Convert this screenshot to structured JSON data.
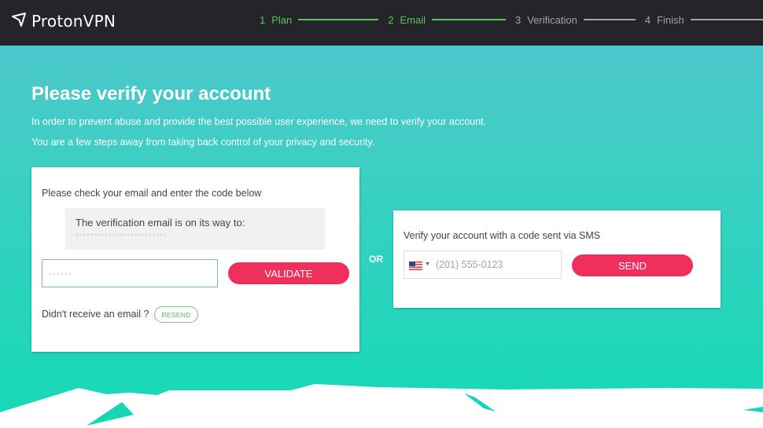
{
  "brand": {
    "name": "ProtonVPN"
  },
  "steps": [
    {
      "num": "1",
      "label": "Plan",
      "state": "done"
    },
    {
      "num": "2",
      "label": "Email",
      "state": "done"
    },
    {
      "num": "3",
      "label": "Verification",
      "state": "todo"
    },
    {
      "num": "4",
      "label": "Finish",
      "state": "todo"
    }
  ],
  "header": {
    "title": "Please verify your account",
    "line1": "In order to prevent abuse and provide the best possible user experience, we need to verify your account.",
    "line2": "You are a few steps away from taking back control of your privacy and security."
  },
  "email_card": {
    "instruction": "Please check your email and enter the code below",
    "notice": "The verification email is on its way to:",
    "address_redacted": "·························",
    "code_redacted": "······",
    "validate_label": "VALIDATE",
    "resend_prompt": "Didn't receive an email ?",
    "resend_label": "RESEND"
  },
  "divider": {
    "label": "OR"
  },
  "sms_card": {
    "instruction": "Verify your account with a code sent via SMS",
    "country_flag": "us-flag-icon",
    "phone_placeholder": "(201) 555-0123",
    "send_label": "SEND"
  },
  "colors": {
    "accent_green": "#56c754",
    "button_pink": "#f0305c",
    "topbar": "#25242b",
    "bg_top": "#52c4cf",
    "bg_bottom": "#14d9b6"
  }
}
